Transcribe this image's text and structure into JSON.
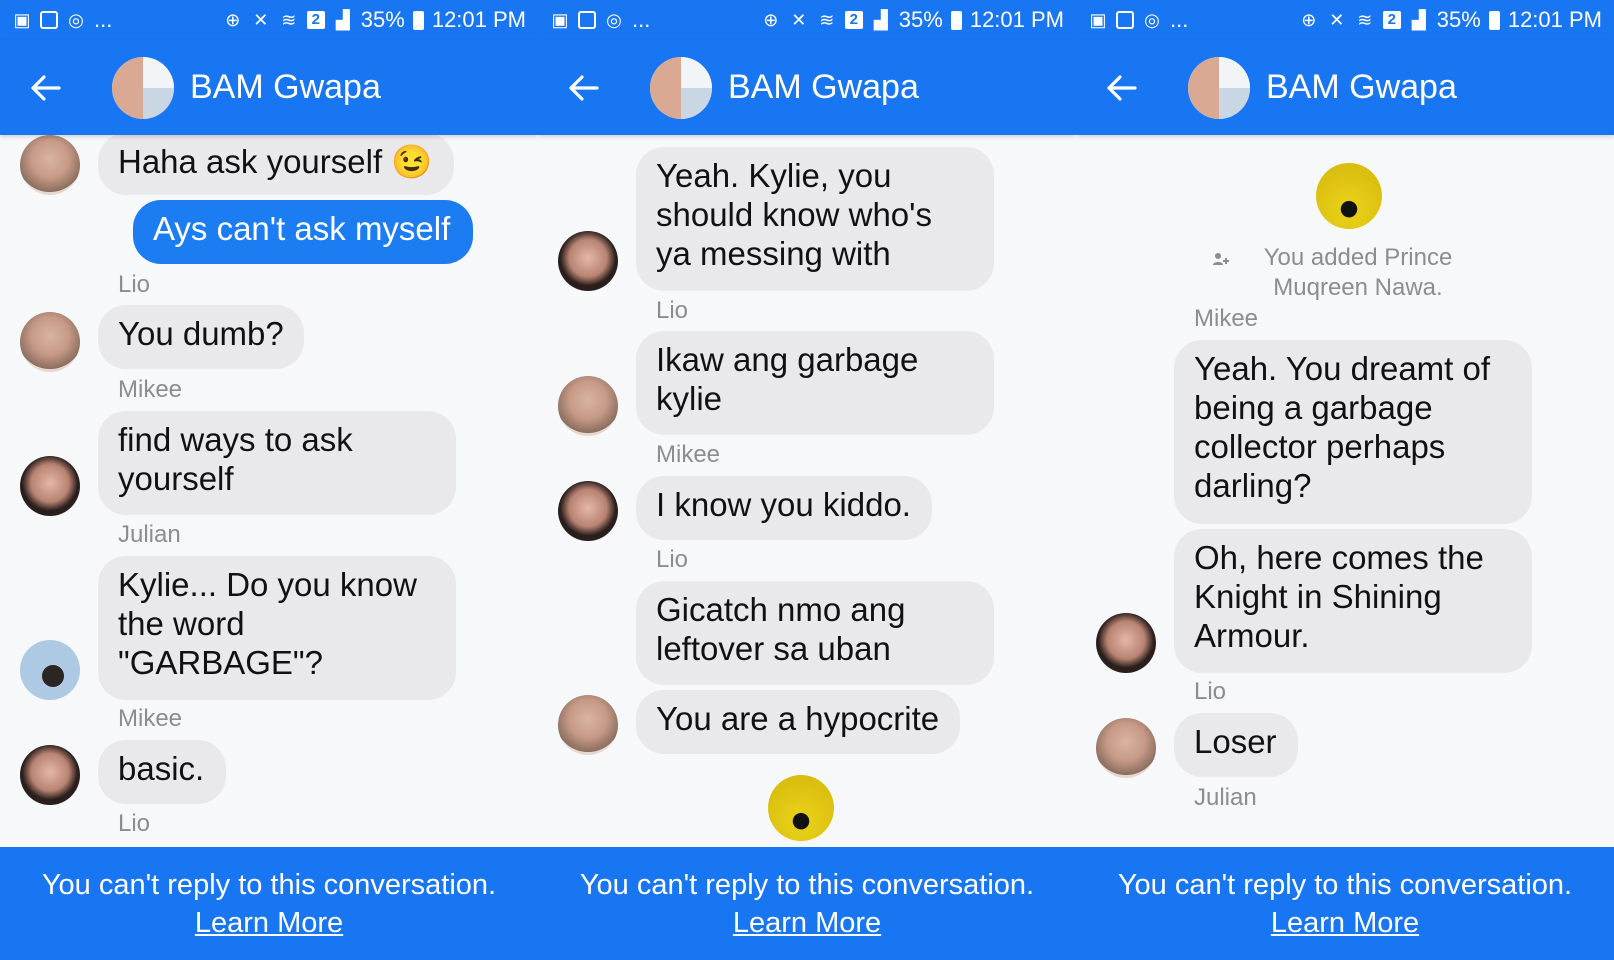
{
  "status_bar": {
    "battery": "35%",
    "time": "12:01 PM",
    "sim_badge": "2",
    "more": "..."
  },
  "colors": {
    "brand_blue": "#1976f2",
    "my_bubble": "#1c7df3",
    "their_bubble": "#e9e9eb"
  },
  "header": {
    "title": "BAM Gwapa"
  },
  "footer": {
    "notice": "You can't reply to this conversation.",
    "learn_more": "Learn More"
  },
  "screens": [
    {
      "messages": [
        {
          "text": "Haha ask yourself 😉"
        },
        {
          "text": "Ays can't ask myself"
        },
        {
          "sender": "Lio",
          "text": "You dumb?"
        },
        {
          "sender": "Mikee",
          "text": "find ways to ask yourself"
        },
        {
          "sender": "Julian",
          "text": "Kylie... Do you know the word \"GARBAGE\"?"
        },
        {
          "sender": "Mikee",
          "text": "basic."
        }
      ],
      "partial_sender": "Lio"
    },
    {
      "messages": [
        {
          "text": "Yeah. Kylie, you should know who's ya messing with"
        },
        {
          "sender": "Lio",
          "text": "Ikaw ang garbage kylie"
        },
        {
          "sender": "Mikee",
          "text": "I know you kiddo."
        },
        {
          "sender": "Lio",
          "text": "Gicatch nmo ang leftover sa uban"
        },
        {
          "text": "You are a hypocrite"
        }
      ]
    },
    {
      "system_text": "You added Prince Muqreen Nawa.",
      "messages": [
        {
          "sender": "Mikee",
          "text": "Yeah. You dreamt of being a garbage collector perhaps darling?"
        },
        {
          "text": "Oh, here comes the Knight in Shining Armour."
        },
        {
          "sender": "Lio",
          "text": "Loser"
        }
      ],
      "trailing_sender": "Julian"
    }
  ]
}
